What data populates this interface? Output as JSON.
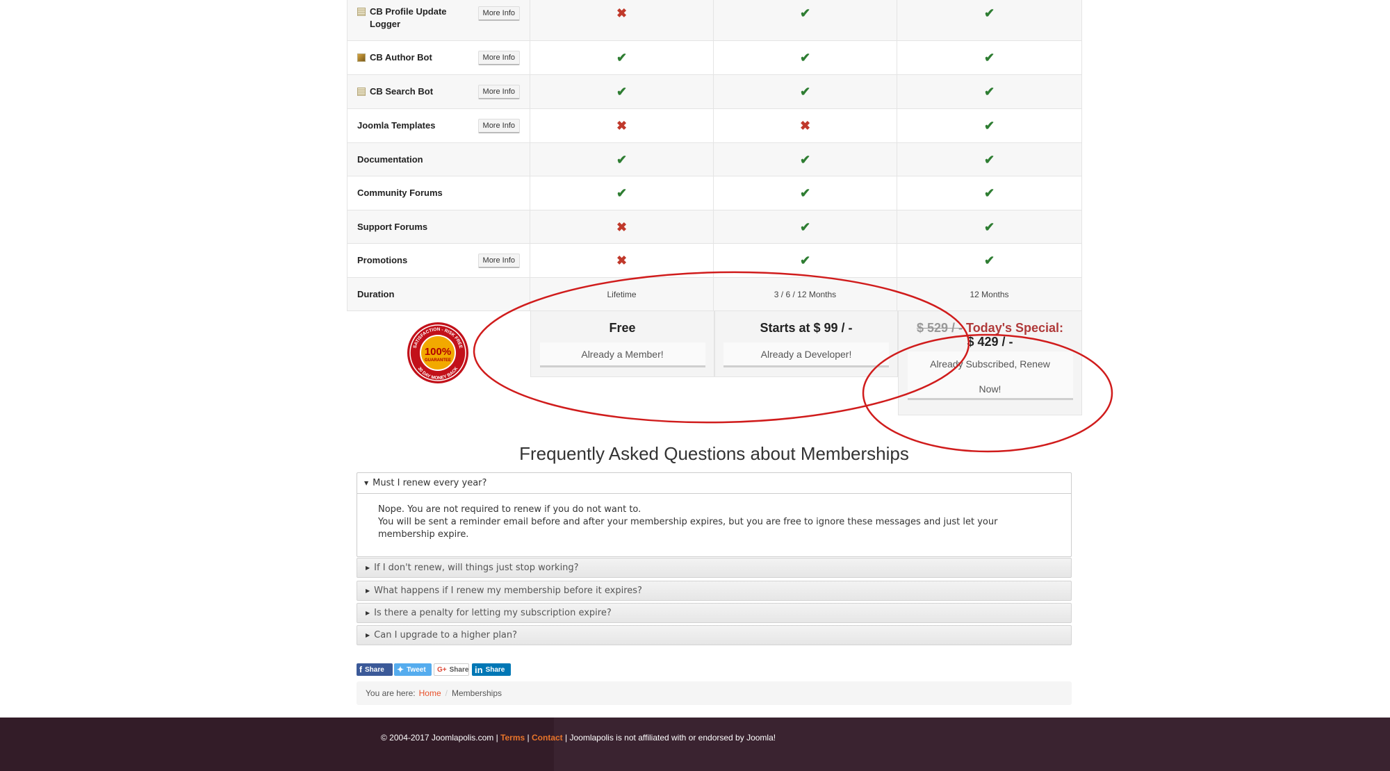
{
  "features": [
    {
      "name": "CB Profile Update Logger",
      "icon": "plugin-icon",
      "more_info": "More Info",
      "cols": [
        "cross",
        "check",
        "check"
      ]
    },
    {
      "name": "CB Author Bot",
      "icon": "pencil-icon",
      "more_info": "More Info",
      "cols": [
        "check",
        "check",
        "check"
      ]
    },
    {
      "name": "CB Search Bot",
      "icon": "plugin-icon",
      "more_info": "More Info",
      "cols": [
        "check",
        "check",
        "check"
      ]
    },
    {
      "name": "Joomla Templates",
      "icon": "",
      "more_info": "More Info",
      "cols": [
        "cross",
        "cross",
        "check"
      ]
    },
    {
      "name": "Documentation",
      "icon": "",
      "more_info": "",
      "cols": [
        "check",
        "check",
        "check"
      ]
    },
    {
      "name": "Community Forums",
      "icon": "",
      "more_info": "",
      "cols": [
        "check",
        "check",
        "check"
      ]
    },
    {
      "name": "Support Forums",
      "icon": "",
      "more_info": "",
      "cols": [
        "cross",
        "check",
        "check"
      ]
    },
    {
      "name": "Promotions",
      "icon": "",
      "more_info": "More Info",
      "cols": [
        "cross",
        "check",
        "check"
      ]
    }
  ],
  "duration": {
    "label": "Duration",
    "values": [
      "Lifetime",
      "3 / 6 / 12 Months",
      "12 Months"
    ]
  },
  "plans": [
    {
      "price": "Free",
      "button": "Already a Member!"
    },
    {
      "price": "Starts at $ 99 / -",
      "button": "Already a Developer!"
    },
    {
      "old_price": "$ 529 / -",
      "special_label": "Today's Special:",
      "price": "$ 429 / -",
      "button_line1": "Already Subscribed, Renew",
      "button_line2": "Now!"
    }
  ],
  "seal": {
    "top": "SATISFACTION - RISK FREE",
    "center": "100%",
    "sub": "GUARANTEE",
    "bottom": "30 DAY MONEY BACK"
  },
  "faq": {
    "title": "Frequently Asked Questions about Memberships",
    "open": {
      "question": "Must I renew every year?",
      "answer_line1": "Nope. You are not required to renew if you do not want to.",
      "answer_line2": "You will be sent a reminder email before and after your membership expires, but you are free to ignore these messages and just let your membership expire."
    },
    "items": [
      "If I don't renew, will things just stop working?",
      "What happens if I renew my membership before it expires?",
      "Is there a penalty for letting my subscription expire?",
      "Can I upgrade to a higher plan?"
    ]
  },
  "share": {
    "facebook": "Share",
    "twitter": "Tweet",
    "google_prefix": "G+",
    "google": "Share",
    "linkedin_prefix": "in",
    "linkedin": "Share",
    "facebook_color": "#3b5998",
    "twitter_color": "#55acee",
    "linkedin_color": "#0077b5"
  },
  "breadcrumb": {
    "prefix": "You are here:",
    "home": "Home",
    "current": "Memberships"
  },
  "footer": {
    "copyright": "© 2004-2017 Joomlapolis.com |",
    "terms": "Terms",
    "sep": "|",
    "contact": "Contact",
    "notice": "| Joomlapolis is not affiliated with or endorsed by Joomla!"
  },
  "colors": {
    "check": "#2e7d32",
    "cross": "#c0392b",
    "annotation": "#d01c1c",
    "footer_bg": "#3a2330",
    "link": "#e8502a"
  }
}
